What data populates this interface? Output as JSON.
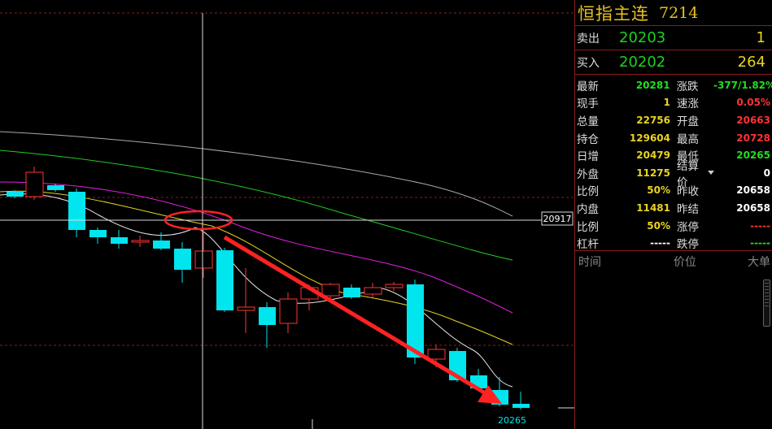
{
  "header": {
    "name": "恒指主连",
    "code": "7214"
  },
  "orderbook": {
    "ask": {
      "label": "卖出",
      "price": "20203",
      "volume": "1"
    },
    "bid": {
      "label": "买入",
      "price": "20202",
      "volume": "264"
    }
  },
  "stats": [
    {
      "l1": "最新",
      "v1": "20281",
      "c1": "green",
      "l2": "涨跌",
      "v2": "-377/1.82%",
      "c2": "green"
    },
    {
      "l1": "现手",
      "v1": "1",
      "c1": "yellow",
      "l2": "速涨",
      "v2": "0.05%",
      "c2": "red"
    },
    {
      "l1": "总量",
      "v1": "22756",
      "c1": "yellow",
      "l2": "开盘",
      "v2": "20663",
      "c2": "red"
    },
    {
      "l1": "持仓",
      "v1": "129604",
      "c1": "yellow",
      "l2": "最高",
      "v2": "20728",
      "c2": "red"
    },
    {
      "l1": "日增",
      "v1": "20479",
      "c1": "yellow",
      "l2": "最低",
      "v2": "20265",
      "c2": "green"
    },
    {
      "l1": "外盘",
      "v1": "11275",
      "c1": "yellow",
      "l2": "结算价",
      "v2": "0",
      "c2": "white",
      "dropdown": true
    },
    {
      "l1": "比例",
      "v1": "50%",
      "c1": "yellow",
      "l2": "昨收",
      "v2": "20658",
      "c2": "white"
    },
    {
      "l1": "内盘",
      "v1": "11481",
      "c1": "yellow",
      "l2": "昨结",
      "v2": "20658",
      "c2": "white"
    },
    {
      "l1": "比例",
      "v1": "50%",
      "c1": "yellow",
      "l2": "涨停",
      "v2": "-----",
      "c2": "red"
    },
    {
      "l1": "杠杆",
      "v1": "-----",
      "c1": "white",
      "l2": "跌停",
      "v2": "-----",
      "c2": "green"
    }
  ],
  "ticks_header": {
    "time": "时间",
    "price": "价位",
    "volume": "大单"
  },
  "chart": {
    "crosshair_price": "20917",
    "low_label": "20265",
    "colors": {
      "up": "#ff3333",
      "down": "#00e5ee",
      "ma5": "#e8e8e8",
      "ma10": "#e8d321",
      "ma20": "#e020e0",
      "ma40": "#22cc22",
      "ma60": "#aaaaaa",
      "arrow": "#ff2222"
    }
  }
}
